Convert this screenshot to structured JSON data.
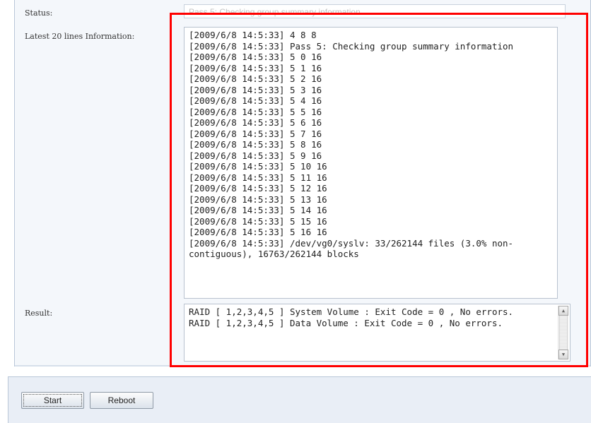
{
  "labels": {
    "status": "Status:",
    "latest": "Latest 20 lines Information:",
    "result": "Result:"
  },
  "status": {
    "value": "Pass 5: Checking group summary information"
  },
  "log_lines": [
    "[2009/6/8 14:5:33] 4 8 8",
    "[2009/6/8 14:5:33] Pass 5: Checking group summary information",
    "[2009/6/8 14:5:33] 5 0 16",
    "[2009/6/8 14:5:33] 5 1 16",
    "[2009/6/8 14:5:33] 5 2 16",
    "[2009/6/8 14:5:33] 5 3 16",
    "[2009/6/8 14:5:33] 5 4 16",
    "[2009/6/8 14:5:33] 5 5 16",
    "[2009/6/8 14:5:33] 5 6 16",
    "[2009/6/8 14:5:33] 5 7 16",
    "[2009/6/8 14:5:33] 5 8 16",
    "[2009/6/8 14:5:33] 5 9 16",
    "[2009/6/8 14:5:33] 5 10 16",
    "[2009/6/8 14:5:33] 5 11 16",
    "[2009/6/8 14:5:33] 5 12 16",
    "[2009/6/8 14:5:33] 5 13 16",
    "[2009/6/8 14:5:33] 5 14 16",
    "[2009/6/8 14:5:33] 5 15 16",
    "[2009/6/8 14:5:33] 5 16 16",
    "[2009/6/8 14:5:33] /dev/vg0/syslv: 33/262144 files (3.0% non-contiguous), 16763/262144 blocks"
  ],
  "result_lines": [
    "RAID [ 1,2,3,4,5 ] System Volume : Exit Code = 0 , No errors.",
    "RAID [ 1,2,3,4,5 ] Data Volume : Exit Code = 0 , No errors."
  ],
  "buttons": {
    "start": "Start",
    "reboot": "Reboot"
  },
  "highlight_color": "#ff0000"
}
